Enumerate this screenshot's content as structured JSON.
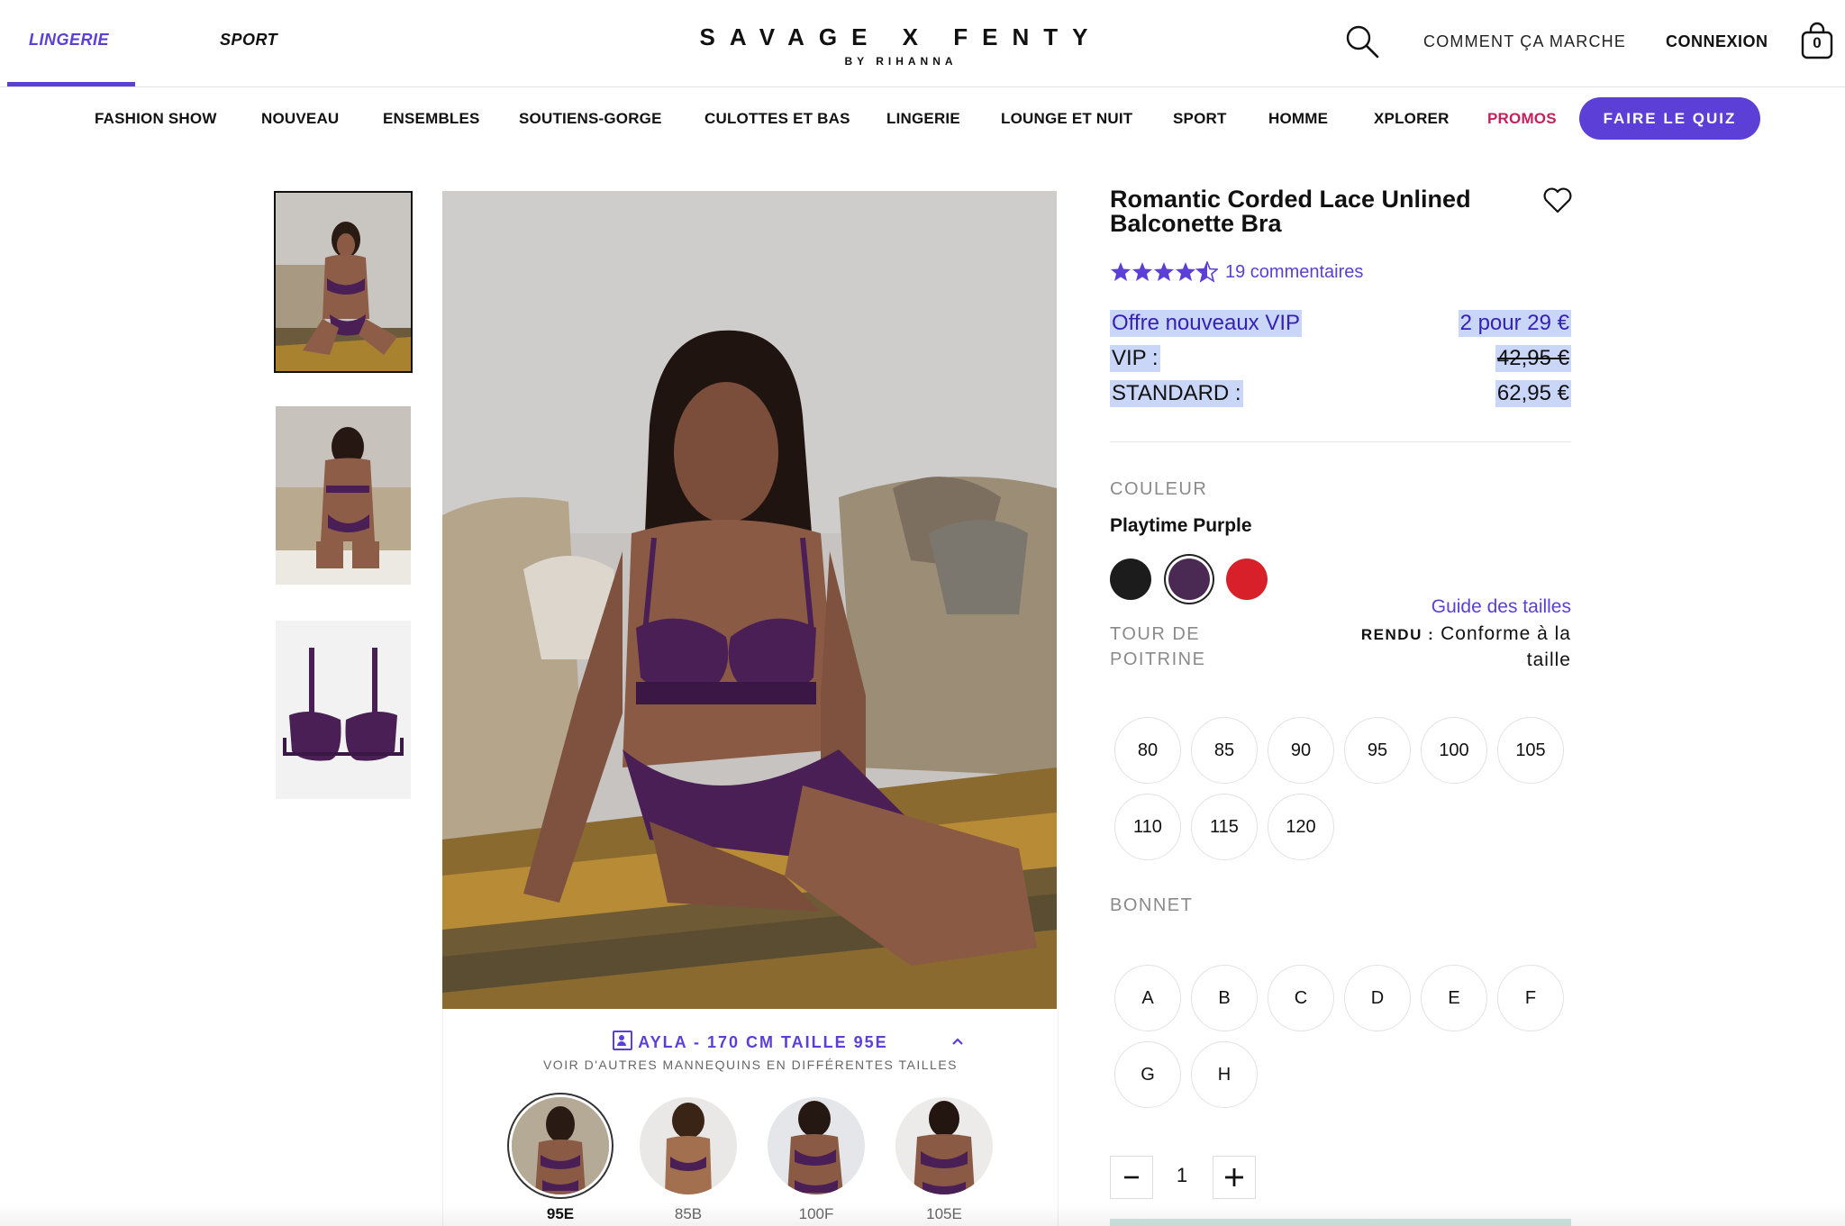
{
  "header": {
    "categories": [
      "LINGERIE",
      "SPORT"
    ],
    "logo_main": "SAVAGE X FENTY",
    "logo_sub": "BY RIHANNA",
    "how_it_works": "COMMENT ÇA MARCHE",
    "login": "CONNEXION",
    "cart_count": "0",
    "accent_color": "#5b3fd6"
  },
  "nav": {
    "items": [
      "FASHION SHOW",
      "NOUVEAU",
      "ENSEMBLES",
      "SOUTIENS-GORGE",
      "CULOTTES ET BAS",
      "LINGERIE",
      "LOUNGE ET NUIT",
      "SPORT",
      "HOMME",
      "XPLORER",
      "PROMOS"
    ],
    "promo_color": "#c4215a",
    "quiz_button": "FAIRE LE QUIZ"
  },
  "gallery": {
    "thumbnails": [
      "model-front-photo",
      "model-back-photo",
      "product-flat-photo"
    ],
    "model_info": "AYLA - 170 CM TAILLE 95E",
    "other_models": "VOIR D'AUTRES MANNEQUINS EN DIFFÉRENTES TAILLES",
    "model_sizes": [
      "95E",
      "85B",
      "100F",
      "105E"
    ]
  },
  "product": {
    "title": "Romantic Corded Lace Unlined Balconette Bra",
    "rating": 4.5,
    "reviews": "19 commentaires",
    "offer_label": "Offre nouveaux VIP",
    "offer_value": "2 pour 29 €",
    "vip_label": "VIP :",
    "vip_price": "42,95 €",
    "standard_label": "STANDARD :",
    "standard_price": "62,95 €",
    "color_label": "COULEUR",
    "color_name": "Playtime Purple",
    "colors": [
      "#1c1c1c",
      "#4a2a52",
      "#d8202a"
    ],
    "size_guide": "Guide des tailles",
    "band_label": "TOUR DE POITRINE",
    "fit_key": "RENDU :",
    "fit_value": "Conforme à la taille",
    "band_sizes": [
      "80",
      "85",
      "90",
      "95",
      "100",
      "105",
      "110",
      "115",
      "120"
    ],
    "cup_label": "BONNET",
    "cup_sizes": [
      "A",
      "B",
      "C",
      "D",
      "E",
      "F",
      "G",
      "H"
    ],
    "quantity": "1"
  }
}
